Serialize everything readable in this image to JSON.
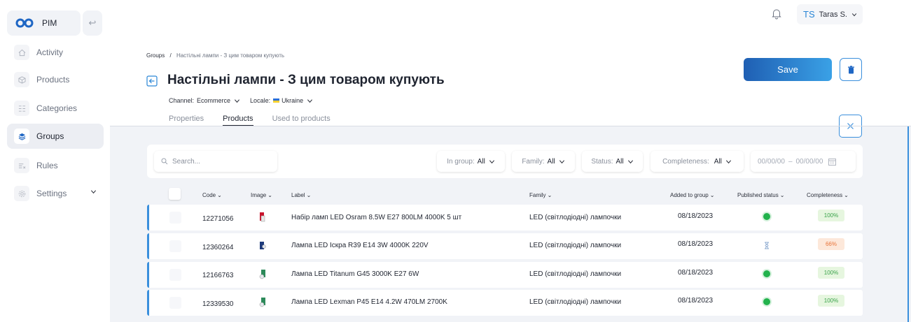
{
  "colors": {
    "accent": "#3a8fdc",
    "success": "#22b24c",
    "warning": "#e8743a"
  },
  "app": {
    "name": "PIM"
  },
  "sidebar": {
    "items": [
      {
        "label": "Activity",
        "icon": "home-icon"
      },
      {
        "label": "Products",
        "icon": "box-icon"
      },
      {
        "label": "Categories",
        "icon": "list-icon"
      },
      {
        "label": "Groups",
        "icon": "layers-icon",
        "active": true
      },
      {
        "label": "Rules",
        "icon": "rules-icon"
      },
      {
        "label": "Settings",
        "icon": "gear-icon",
        "expandable": true
      }
    ]
  },
  "user": {
    "initials": "TS",
    "name": "Taras S."
  },
  "breadcrumb": {
    "parent": "Groups",
    "separator": "/",
    "current": "Настільні лампи - З цим товаром купують"
  },
  "page": {
    "title": "Настільні лампи - З цим товаром купують",
    "channel_label": "Channel:",
    "channel_value": "Ecommerce",
    "locale_label": "Locale:",
    "locale_value": "Ukraine"
  },
  "tabs": [
    {
      "label": "Properties"
    },
    {
      "label": "Products",
      "active": true
    },
    {
      "label": "Used to products"
    }
  ],
  "actions": {
    "save_label": "Save"
  },
  "filters": {
    "search_placeholder": "Search...",
    "in_group": {
      "label": "In group:",
      "value": "All"
    },
    "family": {
      "label": "Family:",
      "value": "All"
    },
    "status": {
      "label": "Status:",
      "value": "All"
    },
    "completeness": {
      "label": "Completeness:",
      "value": "All"
    },
    "date_from": "00/00/00",
    "date_sep": "–",
    "date_to": "00/00/00"
  },
  "table": {
    "columns": {
      "code": "Code",
      "image": "Image",
      "label": "Label",
      "family": "Family",
      "added": "Added to group",
      "published": "Published status",
      "completeness": "Completeness"
    },
    "rows": [
      {
        "code": "12271056",
        "label": "Набір ламп LED Osram 8.5W E27 800LM 4000K 5 шт",
        "family": "LED (світлодіодні) лампочки",
        "added": "08/18/2023",
        "published": "published",
        "completeness": "100%"
      },
      {
        "code": "12360264",
        "label": "Лампа LED Іскра R39 E14 3W 4000K 220V",
        "family": "LED (світлодіодні) лампочки",
        "added": "08/18/2023",
        "published": "pending",
        "completeness": "66%"
      },
      {
        "code": "12166763",
        "label": "Лампа LED Titanum G45 3000K E27 6W",
        "family": "LED (світлодіодні) лампочки",
        "added": "08/18/2023",
        "published": "published",
        "completeness": "100%"
      },
      {
        "code": "12339530",
        "label": "Лампа LED Lexman P45 E14 4.2W 470LM 2700K",
        "family": "LED (світлодіодні) лампочки",
        "added": "08/18/2023",
        "published": "published",
        "completeness": "100%"
      }
    ]
  }
}
